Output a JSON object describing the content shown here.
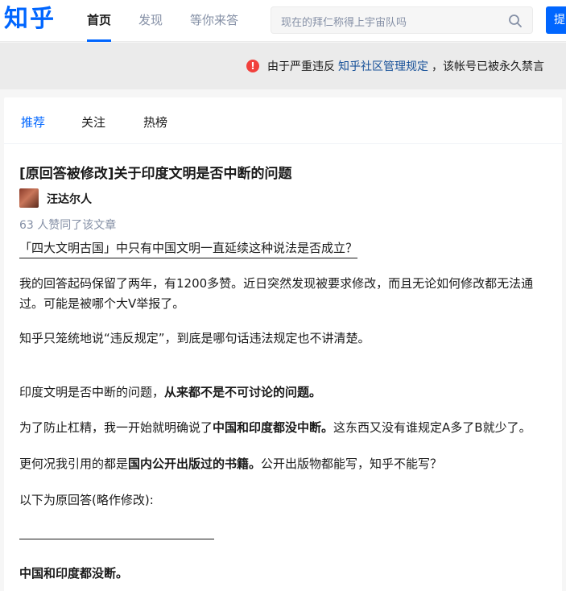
{
  "header": {
    "logo": "知乎",
    "nav": [
      "首页",
      "发现",
      "等你来答"
    ],
    "search_placeholder": "现在的拜仁称得上宇宙队吗",
    "ask_label": "提"
  },
  "banner": {
    "prefix": "由于严重违反",
    "link": "知乎社区管理规定",
    "suffix": "，该帐号已被永久禁言"
  },
  "tabs": [
    "推荐",
    "关注",
    "热榜"
  ],
  "article": {
    "title": "[原回答被修改]关于印度文明是否中断的问题",
    "author": "汪达尔人",
    "likes": "63 人赞同了该文章",
    "question": "「四大文明古国」中只有中国文明一直延续这种说法是否成立？",
    "p1": "我的回答起码保留了两年，有1200多赞。近日突然发现被要求修改，而且无论如何修改都无法通过。可能是被哪个大V举报了。",
    "p2": "知乎只笼统地说“违反规定”，到底是哪句话违法规定也不讲清楚。",
    "p3_a": "印度文明是否中断的问题，",
    "p3_b": "从来都不是不可讨论的问题。",
    "p4_a": "为了防止杠精，我一开始就明确说了",
    "p4_b": "中国和印度都没中断。",
    "p4_c": "这东西又没有谁规定A多了B就少了。",
    "p5_a": "更何况我引用的都是",
    "p5_b": "国内公开出版过的书籍。",
    "p5_c": "公开出版物都能写，知乎不能写？",
    "p6": "以下为原回答(略作修改):",
    "p7": "中国和印度都没断。"
  },
  "colors": {
    "brand": "#0066ff",
    "warning": "#f1403c",
    "link": "#175199"
  }
}
